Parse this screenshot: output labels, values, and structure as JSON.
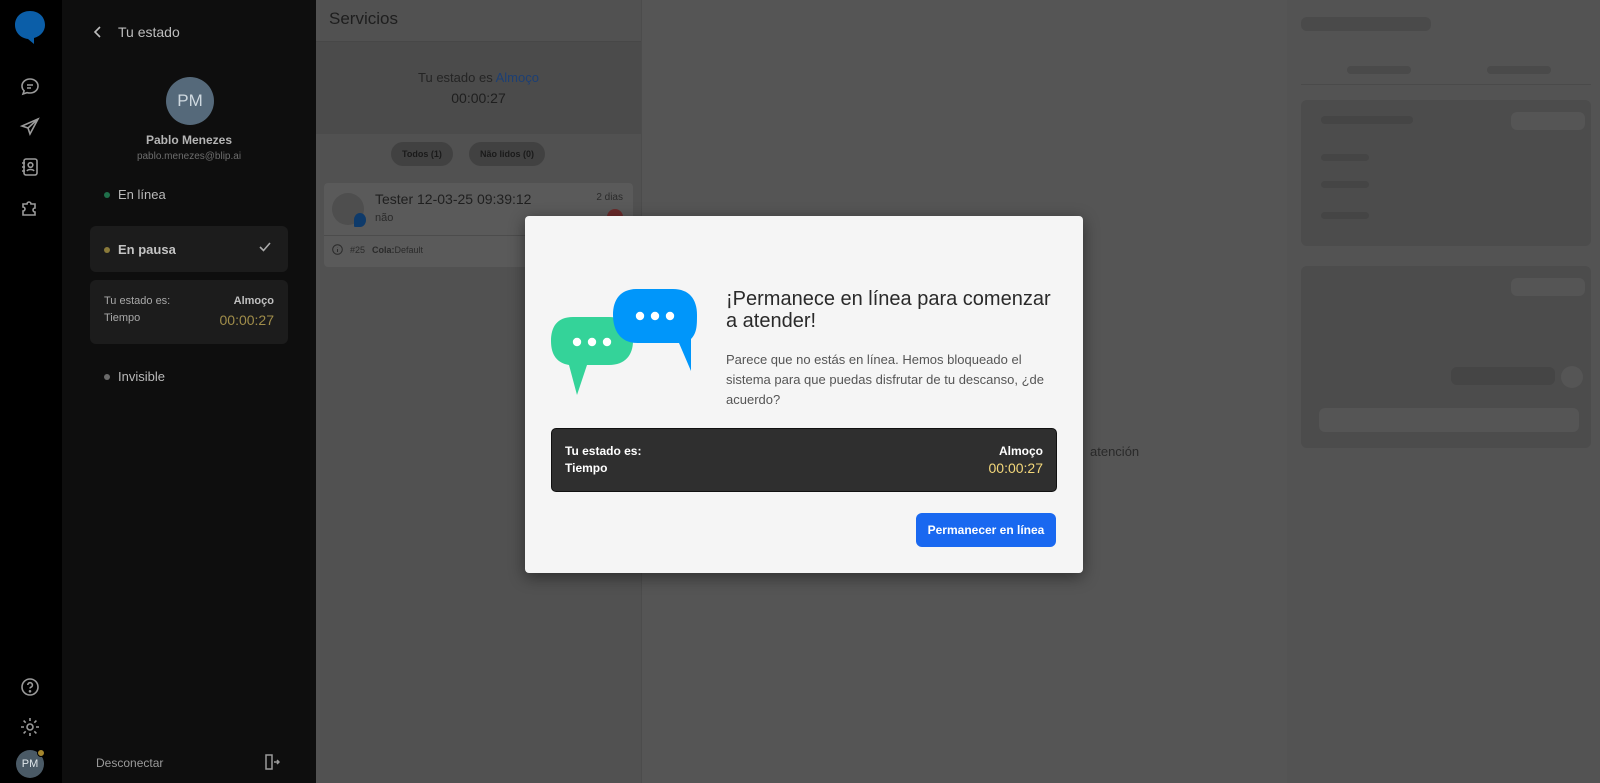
{
  "colors": {
    "accent": "#1968f0",
    "brand": "#0096fa",
    "timer": "#f3d77a"
  },
  "sidebar": {
    "icons": [
      "chat-icon",
      "send-icon",
      "contacts-icon",
      "puzzle-icon",
      "help-icon",
      "settings-icon"
    ],
    "avatar_initials": "PM"
  },
  "status_panel": {
    "title": "Tu estado",
    "avatar_initials": "PM",
    "user_name": "Pablo Menezes",
    "user_email": "pablo.menezes@blip.ai",
    "options": {
      "online": "En línea",
      "paused": "En pausa",
      "invisible": "Invisible"
    },
    "status_label": "Tu estado es:",
    "status_value": "Almoço",
    "time_label": "Tiempo",
    "time_value": "00:00:27",
    "disconnect": "Desconectar"
  },
  "services": {
    "title": "Servicios",
    "status_prefix": "Tu estado es",
    "status_value": "Almoço",
    "timer": "00:00:27",
    "filters": [
      "Todos (1)",
      "Não lidos (0)"
    ],
    "ticket": {
      "name": "Tester 12-03-25 09:39:12",
      "message": "não",
      "age": "2 dias",
      "id": "#25",
      "queue_label": "Cola:",
      "queue_value": "Default"
    }
  },
  "center": {
    "hint": "atención"
  },
  "modal": {
    "title": "¡Permanece en línea para comenzar a atender!",
    "description": "Parece que no estás en línea. Hemos bloqueado el sistema para que puedas disfrutar de tu descanso, ¿de acuerdo?",
    "status_label": "Tu estado es:",
    "status_value": "Almoço",
    "time_label": "Tiempo",
    "time_value": "00:00:27",
    "button": "Permanecer en línea"
  }
}
